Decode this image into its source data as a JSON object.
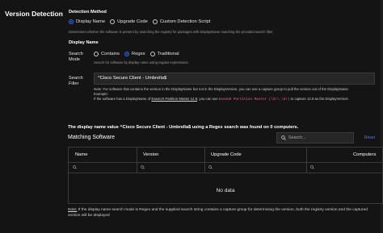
{
  "section": {
    "title": "Version Detection"
  },
  "detection_method": {
    "label": "Detection Method",
    "options": [
      "Display Name",
      "Upgrade Code",
      "Custom Detection Script"
    ],
    "selected": "Display Name",
    "help": "Determines whether the software is present by searching the registry for packages with DisplayName matching the provided search filter"
  },
  "display_name": {
    "label": "Display Name",
    "search_mode_label": "Search Mode",
    "modes": [
      "Contains",
      "Regex",
      "Traditional"
    ],
    "selected_mode": "Regex",
    "mode_help": "Search for software by display name using regular expressions.",
    "search_filter_label": "Search Filter",
    "search_filter_value": "^Cisco Secure Client - Umbrella$",
    "note_line1": "Note: For software that contains the version in the DisplayName but not in the DisplayVersion, you can use a capture group to pull the version out of the DisplayName.",
    "example_label": "Example:",
    "example_prefix": "If the software has a DisplayName of ",
    "example_link": "EaseUS Partition Master 12.9",
    "example_mid": ", you can use ",
    "example_code": "EaseUS Partition Master (\\d+\\.\\d+)",
    "example_suffix": " to capture 12.9 as the DisplayVersion"
  },
  "result_text": "The display name value ^Cisco Secure Client - Umbrella$ using a Regex search was found on 0 computers.",
  "matching": {
    "title": "Matching Software",
    "search_placeholder": "Search...",
    "reset_label": "Reset",
    "columns": [
      "Name",
      "Version",
      "Upgrade Code",
      "Computers"
    ],
    "empty_text": "No data"
  },
  "bottom_note": {
    "prefix": "Note:",
    "text": " If the display name search mode is Regex and the supplied search string contains a capture group for determining the version, both the registry version and the captured version will be displayed"
  },
  "colors": {
    "accent": "#2a6df4",
    "link": "#3c86ff",
    "code": "#ff5f8f"
  },
  "icons": {
    "search": "search-icon",
    "filter": "filter-search-icon"
  }
}
